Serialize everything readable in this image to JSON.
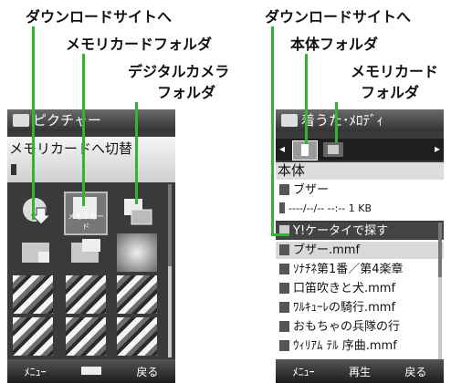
{
  "annotations_left": {
    "download_site": "ダウンロードサイトへ",
    "memory_card_folder": "メモリカードフォルダ",
    "digital_camera_folder_l1": "デジタルカメラ",
    "digital_camera_folder_l2": "フォルダ"
  },
  "annotations_right": {
    "download_site": "ダウンロードサイトへ",
    "phone_folder": "本体フォルダ",
    "memory_card_l1": "メモリカード",
    "memory_card_l2": "フォルダ"
  },
  "left_screen": {
    "title": "ピクチャー",
    "switch_label": "メモリカードへ切替",
    "tile_sd_label": "メモリカード",
    "softkeys": {
      "left": "ﾒﾆｭｰ",
      "right": "戻る"
    }
  },
  "right_screen": {
    "title": "着うた･ﾒﾛﾃﾞｨ",
    "location": "本体",
    "buzzer": "ブザー",
    "date_line": "----/--/-- --:-- 1 KB",
    "items": [
      "Y!ケータイで探す",
      "ブザー.mmf",
      "ｿﾅﾁﾈ第1番／第4楽章",
      "口笛吹きと犬.mmf",
      "ﾜﾙｷｭｰﾚの騎行.mmf",
      "おもちゃの兵隊の行",
      "ｳｨﾘｱﾑ ﾃﾙ 序曲.mmf"
    ],
    "softkeys": {
      "left": "ﾒﾆｭｰ",
      "center": "再生",
      "right": "戻る"
    }
  },
  "colors": {
    "annotation_line": "#2fb52f",
    "highlight": "#d9d9d9"
  }
}
